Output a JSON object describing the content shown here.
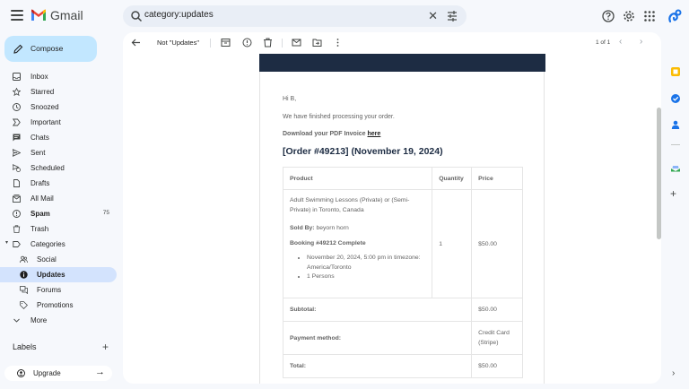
{
  "app": {
    "name": "Gmail"
  },
  "search": {
    "query": "category:updates"
  },
  "sidebar": {
    "compose_label": "Compose",
    "items": [
      {
        "label": "Inbox",
        "icon": "inbox-icon"
      },
      {
        "label": "Starred",
        "icon": "star-icon"
      },
      {
        "label": "Snoozed",
        "icon": "clock-icon"
      },
      {
        "label": "Important",
        "icon": "important-icon"
      },
      {
        "label": "Chats",
        "icon": "chat-icon"
      },
      {
        "label": "Sent",
        "icon": "send-icon"
      },
      {
        "label": "Scheduled",
        "icon": "scheduled-icon"
      },
      {
        "label": "Drafts",
        "icon": "draft-icon"
      },
      {
        "label": "All Mail",
        "icon": "all-mail-icon"
      },
      {
        "label": "Spam",
        "icon": "spam-icon",
        "count": "75"
      },
      {
        "label": "Trash",
        "icon": "trash-icon"
      },
      {
        "label": "Categories",
        "icon": "label-icon"
      },
      {
        "label": "Social",
        "icon": "social-icon"
      },
      {
        "label": "Updates",
        "icon": "info-icon"
      },
      {
        "label": "Forums",
        "icon": "forum-icon"
      },
      {
        "label": "Promotions",
        "icon": "tag-icon"
      },
      {
        "label": "More",
        "icon": "chevron-down-icon"
      }
    ],
    "labels_heading": "Labels",
    "upgrade_label": "Upgrade"
  },
  "toolbar": {
    "mark_label": "Not \"Updates\"",
    "pager": "1 of 1"
  },
  "email": {
    "greeting": "Hi B,",
    "intro": "We have finished processing your order.",
    "download_prefix": "Download your PDF Invoice ",
    "download_link": "here",
    "order_title": "[Order #49213] (November 19, 2024)",
    "table": {
      "headers": {
        "product": "Product",
        "quantity": "Quantity",
        "price": "Price"
      },
      "item": {
        "name": "Adult Swimming Lessons (Private) or (Semi-Private) in Toronto, Canada",
        "sold_by_label": "Sold By:",
        "sold_by_value": "beyorn horn",
        "booking": "Booking #49212 Complete",
        "details": [
          "November 20, 2024, 5:00 pm in timezone: America/Toronto",
          "1 Persons"
        ],
        "quantity": "1",
        "price": "$50.00"
      },
      "totals": [
        {
          "label": "Subtotal:",
          "value": "$50.00"
        },
        {
          "label": "Payment method:",
          "value": "Credit Card (Stripe)"
        },
        {
          "label": "Total:",
          "value": "$50.00"
        }
      ]
    }
  },
  "colors": {
    "compose": "#c2e7ff",
    "active": "#d3e3fd",
    "banner": "#1d2c43"
  }
}
